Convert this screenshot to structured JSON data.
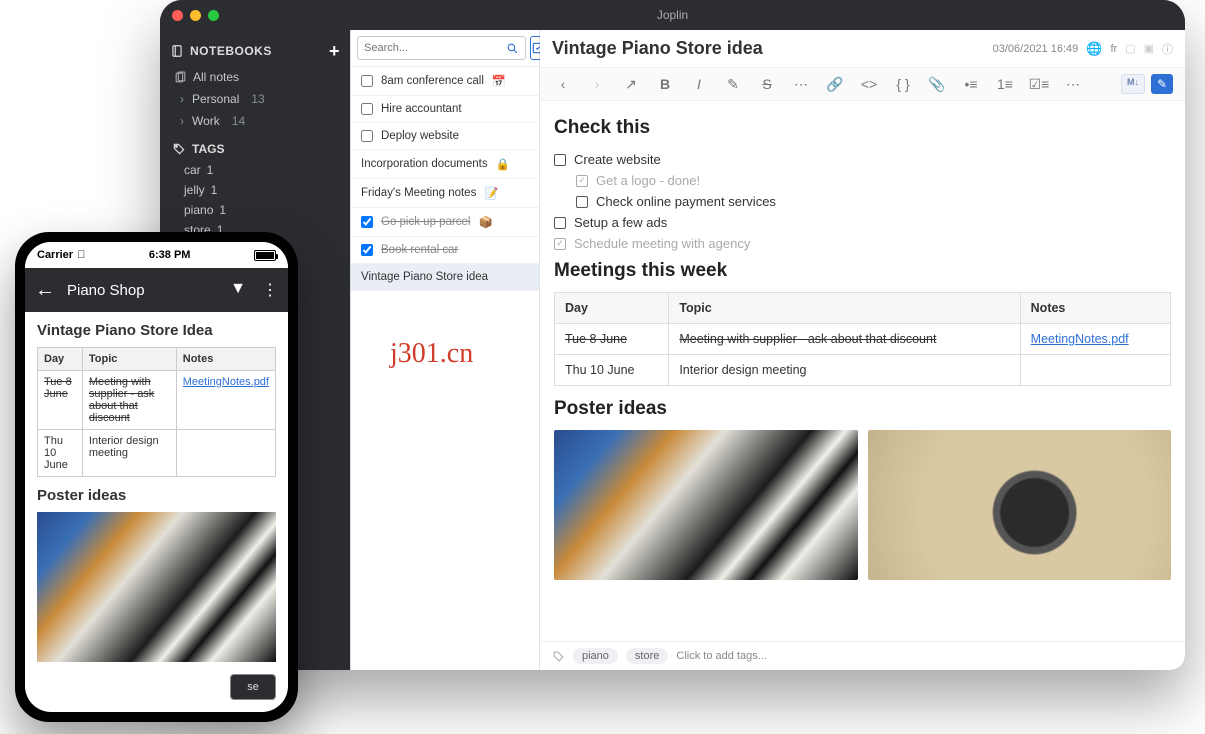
{
  "watermark": "j301.cn",
  "desktop": {
    "window_title": "Joplin",
    "sidebar": {
      "notebooks_label": "NOTEBOOKS",
      "all_notes": "All notes",
      "folders": [
        {
          "name": "Personal",
          "count": "13"
        },
        {
          "name": "Work",
          "count": "14"
        }
      ],
      "tags_label": "TAGS",
      "tags": [
        {
          "name": "car",
          "count": "1"
        },
        {
          "name": "jelly",
          "count": "1"
        },
        {
          "name": "piano",
          "count": "1"
        },
        {
          "name": "store",
          "count": "1"
        }
      ]
    },
    "notelist": {
      "search_placeholder": "Search...",
      "items": [
        {
          "label": "8am conference call",
          "checkbox": true,
          "checked": false,
          "emoji": "📅"
        },
        {
          "label": "Hire accountant",
          "checkbox": true,
          "checked": false
        },
        {
          "label": "Deploy website",
          "checkbox": true,
          "checked": false
        },
        {
          "label": "Incorporation documents",
          "checkbox": false,
          "emoji": "🔒"
        },
        {
          "label": "Friday's Meeting notes",
          "checkbox": false,
          "emoji": "📝"
        },
        {
          "label": "Go pick up parcel",
          "checkbox": true,
          "checked": true,
          "emoji": "📦",
          "strike": true
        },
        {
          "label": "Book rental car",
          "checkbox": true,
          "checked": true,
          "strike": true
        },
        {
          "label": "Vintage Piano Store idea",
          "checkbox": false,
          "selected": true
        }
      ]
    },
    "editor": {
      "title": "Vintage Piano Store idea",
      "datetime": "03/06/2021 16:49",
      "lang": "fr",
      "sections": {
        "check_heading": "Check this",
        "checks": [
          {
            "label": "Create website",
            "done": false,
            "sub": false
          },
          {
            "label": "Get a logo - done!",
            "done": true,
            "sub": true
          },
          {
            "label": "Check online payment services",
            "done": false,
            "sub": true
          },
          {
            "label": "Setup a few ads",
            "done": false,
            "sub": false
          },
          {
            "label": "Schedule meeting with agency",
            "done": true,
            "sub": false
          }
        ],
        "meet_heading": "Meetings this week",
        "table": {
          "headers": [
            "Day",
            "Topic",
            "Notes"
          ],
          "rows": [
            {
              "day": "Tue 8 June",
              "day_strike": true,
              "topic": "Meeting with supplier - ask about that discount",
              "topic_strike": true,
              "notes": "MeetingNotes.pdf",
              "notes_link": true
            },
            {
              "day": "Thu 10 June",
              "topic": "Interior design meeting",
              "notes": ""
            }
          ]
        },
        "poster_heading": "Poster ideas"
      },
      "tagbar": {
        "tags": [
          "piano",
          "store"
        ],
        "placeholder": "Click to add tags..."
      }
    }
  },
  "phone": {
    "carrier": "Carrier",
    "time": "6:38 PM",
    "nav_title": "Piano Shop",
    "note_title": "Vintage Piano Store Idea",
    "table": {
      "headers": [
        "Day",
        "Topic",
        "Notes"
      ],
      "rows": [
        {
          "day": "Tue 8 June",
          "day_strike": true,
          "topic": "Meeting with supplier - ask about that discount",
          "topic_strike": true,
          "notes": "MeetingNotes.pdf",
          "notes_link": true
        },
        {
          "day": "Thu 10 June",
          "topic": "Interior design meeting",
          "notes": ""
        }
      ]
    },
    "poster_heading": "Poster ideas",
    "button": "se"
  }
}
